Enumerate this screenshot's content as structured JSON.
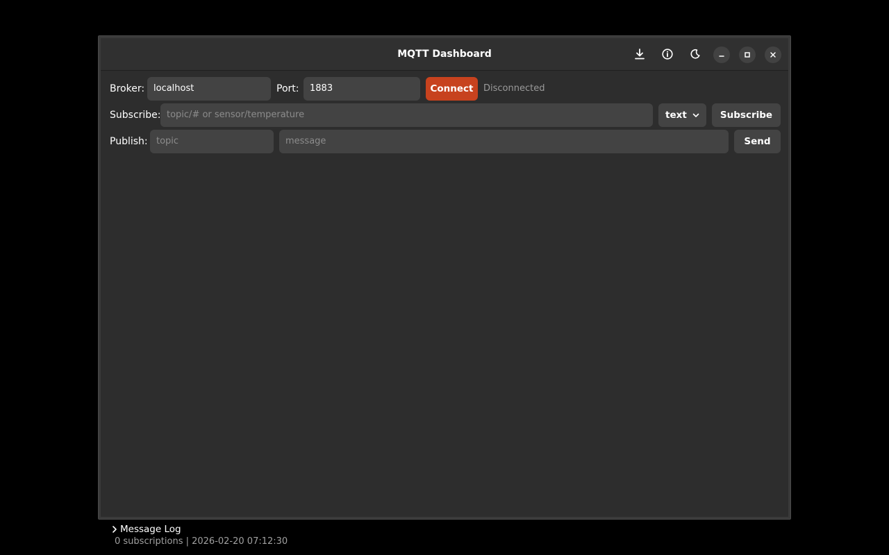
{
  "window": {
    "title": "MQTT Dashboard"
  },
  "titlebar_icons": [
    "download-icon",
    "info-icon",
    "moon-icon"
  ],
  "window_controls": [
    "minimize-icon",
    "maximize-icon",
    "close-icon"
  ],
  "connection": {
    "broker_label": "Broker:",
    "broker_value": "localhost",
    "port_label": "Port:",
    "port_value": "1883",
    "connect_label": "Connect",
    "status": "Disconnected"
  },
  "subscribe": {
    "label": "Subscribe:",
    "placeholder": "topic/# or sensor/temperature",
    "format_selected": "text",
    "button_label": "Subscribe"
  },
  "publish": {
    "label": "Publish:",
    "topic_placeholder": "topic",
    "message_placeholder": "message",
    "button_label": "Send"
  },
  "log": {
    "toggle_label": "Message Log",
    "status_text": "0 subscriptions | 2026-02-20 07:12:30"
  },
  "colors": {
    "accent": "#c7421e",
    "background": "#2d2d2d",
    "field": "#434343"
  }
}
